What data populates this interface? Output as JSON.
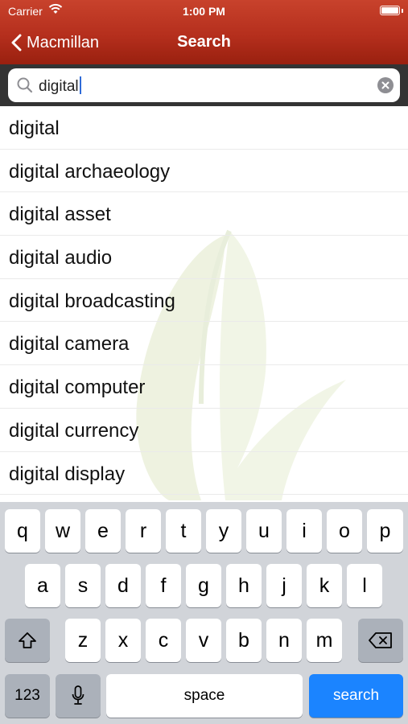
{
  "status_bar": {
    "carrier": "Carrier",
    "time": "1:00 PM"
  },
  "nav": {
    "back_label": "Macmillan",
    "title": "Search"
  },
  "search": {
    "value": "digital"
  },
  "results": [
    "digital",
    "digital archaeology",
    "digital asset",
    "digital audio",
    "digital broadcasting",
    "digital camera",
    "digital computer",
    "digital currency",
    "digital display"
  ],
  "keyboard": {
    "row1": [
      "q",
      "w",
      "e",
      "r",
      "t",
      "y",
      "u",
      "i",
      "o",
      "p"
    ],
    "row2": [
      "a",
      "s",
      "d",
      "f",
      "g",
      "h",
      "j",
      "k",
      "l"
    ],
    "row3": [
      "z",
      "x",
      "c",
      "v",
      "b",
      "n",
      "m"
    ],
    "numbers_label": "123",
    "space_label": "space",
    "search_label": "search"
  },
  "colors": {
    "nav_bar": "#b52f1d",
    "search_key": "#1b84ff",
    "keyboard_bg": "#d1d4d9"
  }
}
